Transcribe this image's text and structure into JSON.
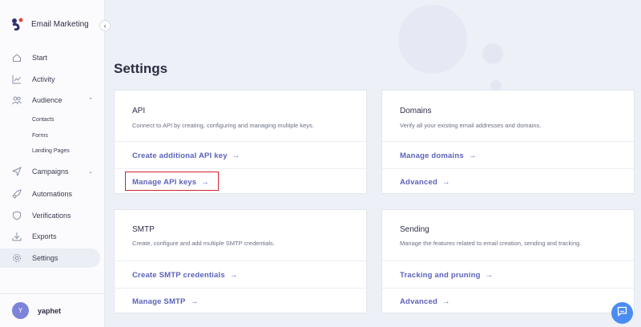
{
  "app": {
    "title": "Email Marketing"
  },
  "sidebar": {
    "collapse_icon": "‹",
    "items": [
      {
        "label": "Start",
        "icon": "home-icon"
      },
      {
        "label": "Activity",
        "icon": "chart-line-icon"
      },
      {
        "label": "Audience",
        "icon": "users-icon",
        "chevron": "⌃"
      },
      {
        "label": "Campaigns",
        "icon": "paper-plane-icon",
        "chevron": "⌄"
      },
      {
        "label": "Automations",
        "icon": "rocket-icon"
      },
      {
        "label": "Verifications",
        "icon": "shield-icon"
      },
      {
        "label": "Exports",
        "icon": "download-icon"
      },
      {
        "label": "Settings",
        "icon": "gear-icon"
      }
    ],
    "audience_sub": [
      "Contacts",
      "Forms",
      "Landing Pages"
    ],
    "user": {
      "initial": "Y",
      "name": "yaphet"
    }
  },
  "page": {
    "title": "Settings"
  },
  "cards": {
    "api": {
      "title": "API",
      "desc": "Connect to API by creating, configuring and managing multiple keys.",
      "links": [
        "Create additional API key",
        "Manage API keys"
      ]
    },
    "domains": {
      "title": "Domains",
      "desc": "Verify all your existing email addresses and domains.",
      "links": [
        "Manage domains",
        "Advanced"
      ]
    },
    "smtp": {
      "title": "SMTP",
      "desc": "Create, configure and add multiple SMTP credentials.",
      "links": [
        "Create SMTP credentials",
        "Manage SMTP"
      ]
    },
    "sending": {
      "title": "Sending",
      "desc": "Manage the features related to email creation, sending and tracking.",
      "links": [
        "Tracking and pruning",
        "Advanced"
      ]
    }
  },
  "arrow": "→",
  "colors": {
    "accent": "#5b62b8",
    "highlight": "#d0242d",
    "chat": "#4a8cf2"
  }
}
